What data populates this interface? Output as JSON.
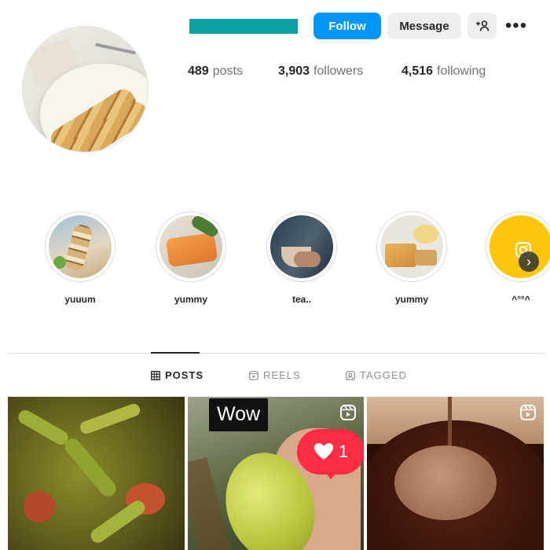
{
  "profile": {
    "username_bar_color": "#0aa0a4",
    "buttons": {
      "follow": "Follow",
      "message": "Message"
    },
    "stats": [
      {
        "value": "489",
        "label": "posts"
      },
      {
        "value": "3,903",
        "label": "followers"
      },
      {
        "value": "4,516",
        "label": "following"
      }
    ]
  },
  "highlights": [
    {
      "label": "yuuum"
    },
    {
      "label": "yummy"
    },
    {
      "label": "tea.."
    },
    {
      "label": "yummy"
    },
    {
      "label": "^°°^"
    }
  ],
  "tabs": [
    {
      "label": "POSTS",
      "icon": "grid-icon",
      "active": true
    },
    {
      "label": "REELS",
      "icon": "reels-icon",
      "active": false
    },
    {
      "label": "TAGGED",
      "icon": "tagged-icon",
      "active": false
    }
  ],
  "posts": [
    {
      "type": "image"
    },
    {
      "type": "reel",
      "overlay_text": "Wow",
      "like_count": "1"
    },
    {
      "type": "reel"
    }
  ],
  "colors": {
    "accent": "#0095f6",
    "like": "#fe2b45",
    "highlight_yellow": "#fcc60b"
  }
}
